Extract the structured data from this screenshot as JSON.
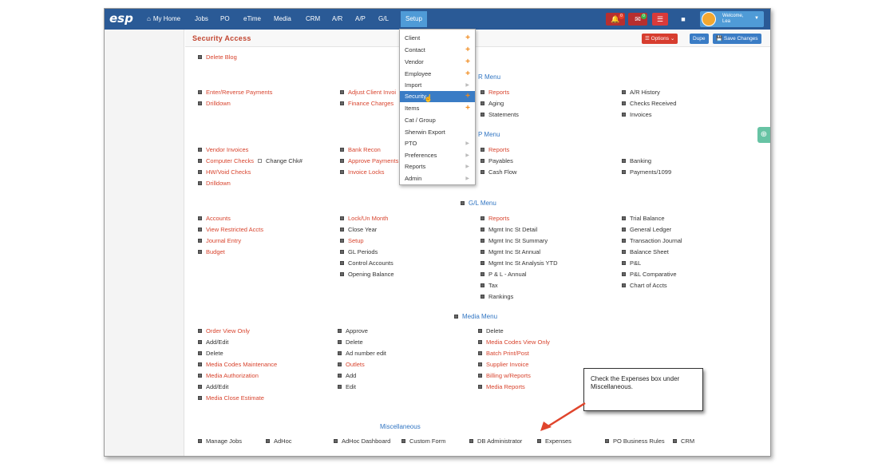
{
  "app": {
    "logo": "esp",
    "nav": [
      {
        "label": "My Home",
        "icon": "home-icon"
      },
      {
        "label": "Jobs"
      },
      {
        "label": "PO"
      },
      {
        "label": "eTime"
      },
      {
        "label": "Media"
      },
      {
        "label": "CRM"
      },
      {
        "label": "A/R"
      },
      {
        "label": "A/P"
      },
      {
        "label": "G/L"
      },
      {
        "label": "Setup",
        "active": true
      }
    ],
    "right_icons": [
      {
        "name": "bell-icon",
        "badge": "0",
        "badge_color": "#e8412a",
        "bg": "#b72f2f"
      },
      {
        "name": "mail-icon",
        "badge": "0",
        "badge_color": "#3bb54a",
        "bg": "#b72f2f"
      },
      {
        "name": "database-icon",
        "bg": "#d93a3a"
      },
      {
        "name": "book-icon",
        "bg": "#2a5a96"
      }
    ],
    "welcome": "Welcome,",
    "user": "Lea",
    "colors": {
      "nav_bg": "#2a5a96",
      "active": "#4f9bd7",
      "red_text": "#d8442e",
      "section_blue": "#3276c3",
      "options": "#d73d2f",
      "dupe": "#3a7cc5",
      "save": "#3a7cc5"
    }
  },
  "toolbar": {
    "title": "Security Access",
    "options": "Options",
    "dupe": "Dupe",
    "save": "Save Changes"
  },
  "dropdown": [
    {
      "label": "Client",
      "suffix": "plus"
    },
    {
      "label": "Contact",
      "suffix": "plus"
    },
    {
      "label": "Vendor",
      "suffix": "plus"
    },
    {
      "label": "Employee",
      "suffix": "plus"
    },
    {
      "label": "Import",
      "suffix": "arrow"
    },
    {
      "label": "Security",
      "suffix": "plus",
      "highlight": true
    },
    {
      "label": "Items",
      "suffix": "plus"
    },
    {
      "label": "Cat / Group"
    },
    {
      "label": "Sherwin Export"
    },
    {
      "label": "PTO",
      "suffix": "arrow"
    },
    {
      "label": "Preferences",
      "suffix": "arrow"
    },
    {
      "label": "Reports",
      "suffix": "arrow"
    },
    {
      "label": "Admin",
      "suffix": "arrow"
    }
  ],
  "sections": {
    "ar_menu": "R Menu",
    "ap_menu": "P Menu",
    "gl_menu": "G/L Menu",
    "media_menu": "Media Menu",
    "misc": "Miscellaneous"
  },
  "items": {
    "delete_blog": "Delete Blog",
    "enter_reverse": "Enter/Reverse Payments",
    "drilldown1": "Drilldown",
    "adjust_client": "Adjust Client Invoi",
    "finance_charges": "Finance Charges",
    "ar_reports": "Reports",
    "aging": "Aging",
    "statements": "Statements",
    "ar_history": "A/R History",
    "checks_received": "Checks Received",
    "invoices": "Invoices",
    "vendor_invoices": "Vendor Invoices",
    "computer_checks": "Computer Checks",
    "change_chk": "Change Chk#",
    "hw_void": "HW/Void Checks",
    "drilldown2": "Drilldown",
    "bank_recon": "Bank Recon",
    "approve_payments": "Approve Payments",
    "invoice_locks": "Invoice Locks",
    "ap_reports": "Reports",
    "payables": "Payables",
    "cash_flow": "Cash Flow",
    "banking": "Banking",
    "payments_1099": "Payments/1099",
    "accounts": "Accounts",
    "view_restricted": "View Restricted Accts",
    "journal_entry": "Journal Entry",
    "budget": "Budget",
    "lock_un_month": "Lock/Un Month",
    "close_year": "Close Year",
    "gl_setup": "Setup",
    "gl_periods": "GL Periods",
    "control_accounts": "Control Accounts",
    "opening_balance": "Opening Balance",
    "gl_reports": "Reports",
    "mgmt_detail": "Mgmt Inc St Detail",
    "mgmt_summary": "Mgmt Inc St Summary",
    "mgmt_annual": "Mgmt Inc St Annual",
    "mgmt_ytd": "Mgmt Inc St Analysis YTD",
    "pl_annual": "P & L - Annual",
    "tax": "Tax",
    "rankings": "Rankings",
    "trial_balance": "Trial Balance",
    "general_ledger": "General Ledger",
    "transaction_journal": "Transaction Journal",
    "balance_sheet": "Balance Sheet",
    "pl": "P&L",
    "pl_comparative": "P&L Comparative",
    "chart_of_accts": "Chart of Accts",
    "order_view_only": "Order View Only",
    "add_edit1": "Add/Edit",
    "delete1": "Delete",
    "media_codes_maint": "Media Codes Maintenance",
    "media_authorization": "Media Authorization",
    "add_edit2": "Add/Edit",
    "media_close_estimate": "Media Close Estimate",
    "approve": "Approve",
    "delete2": "Delete",
    "ad_number_edit": "Ad number edit",
    "outlets": "Outlets",
    "add": "Add",
    "edit": "Edit",
    "delete3": "Delete",
    "media_codes_view": "Media Codes View Only",
    "batch_print": "Batch Print/Post",
    "supplier_invoice": "Supplier Invoice",
    "billing_reports": "Billing w/Reports",
    "media_reports": "Media Reports",
    "manage_jobs": "Manage Jobs",
    "adhoc": "AdHoc",
    "adhoc_dashboard": "AdHoc Dashboard",
    "custom_form": "Custom Form",
    "db_admin": "DB Administrator",
    "expenses": "Expenses",
    "po_business_rules": "PO Business Rules",
    "crm": "CRM"
  },
  "callout": "Check the Expenses box under Miscellaneous."
}
